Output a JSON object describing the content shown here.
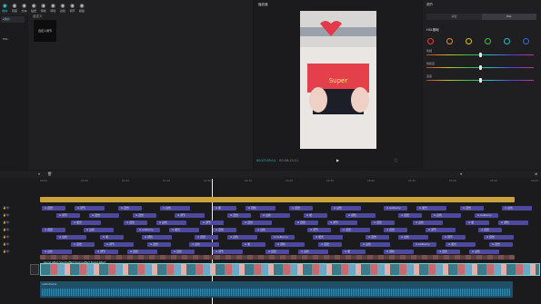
{
  "toolbar": {
    "items": [
      {
        "icon": "import-icon",
        "label": "媒体"
      },
      {
        "icon": "music-icon",
        "label": "音频"
      },
      {
        "icon": "text-icon",
        "label": "文本"
      },
      {
        "icon": "sticker-icon",
        "label": "贴纸"
      },
      {
        "icon": "effects-icon",
        "label": "特效"
      },
      {
        "icon": "transition-icon",
        "label": "转场"
      },
      {
        "icon": "filter-icon",
        "label": "滤镜"
      },
      {
        "icon": "adjust-icon",
        "label": "调节"
      },
      {
        "icon": "template-icon",
        "label": "模板"
      }
    ]
  },
  "sidebar": {
    "items": [
      "▸我的",
      "HSL"
    ],
    "section": "自定义"
  },
  "card_label": "自定义调节",
  "preview": {
    "title": "播放器",
    "timecode": "00:27:09:11",
    "duration": "00:06:15:11",
    "caption": "Super"
  },
  "right": {
    "title": "调节",
    "tabs": [
      "基础",
      "HSL"
    ],
    "section": "HSL基础",
    "sliders": [
      {
        "label": "色相",
        "value": 0.0
      },
      {
        "label": "饱和度",
        "value": 0.0
      },
      {
        "label": "亮度",
        "value": 0.0
      }
    ],
    "swatches": [
      "#e03a3a",
      "#e88a2a",
      "#e0c020",
      "#3ac24a",
      "#2ab8c8",
      "#3a6ae0"
    ]
  },
  "timeline": {
    "ruler": [
      "00:00",
      "00:30",
      "01:00",
      "01:30",
      "02:00",
      "02:30",
      "03:00",
      "03:30",
      "04:00",
      "04:30",
      "05:00",
      "05:30",
      "06:00"
    ],
    "clip_labels": [
      "自然",
      "调节",
      "自然",
      "白色",
      "暖",
      "调色",
      "自然",
      "白色",
      "bellbarry",
      "暖光",
      "自然",
      "白色",
      "调节",
      "自然"
    ],
    "video_label": "Sound effect Sound effect Sound effect Sound effect",
    "audio_label": "audiotracks"
  }
}
